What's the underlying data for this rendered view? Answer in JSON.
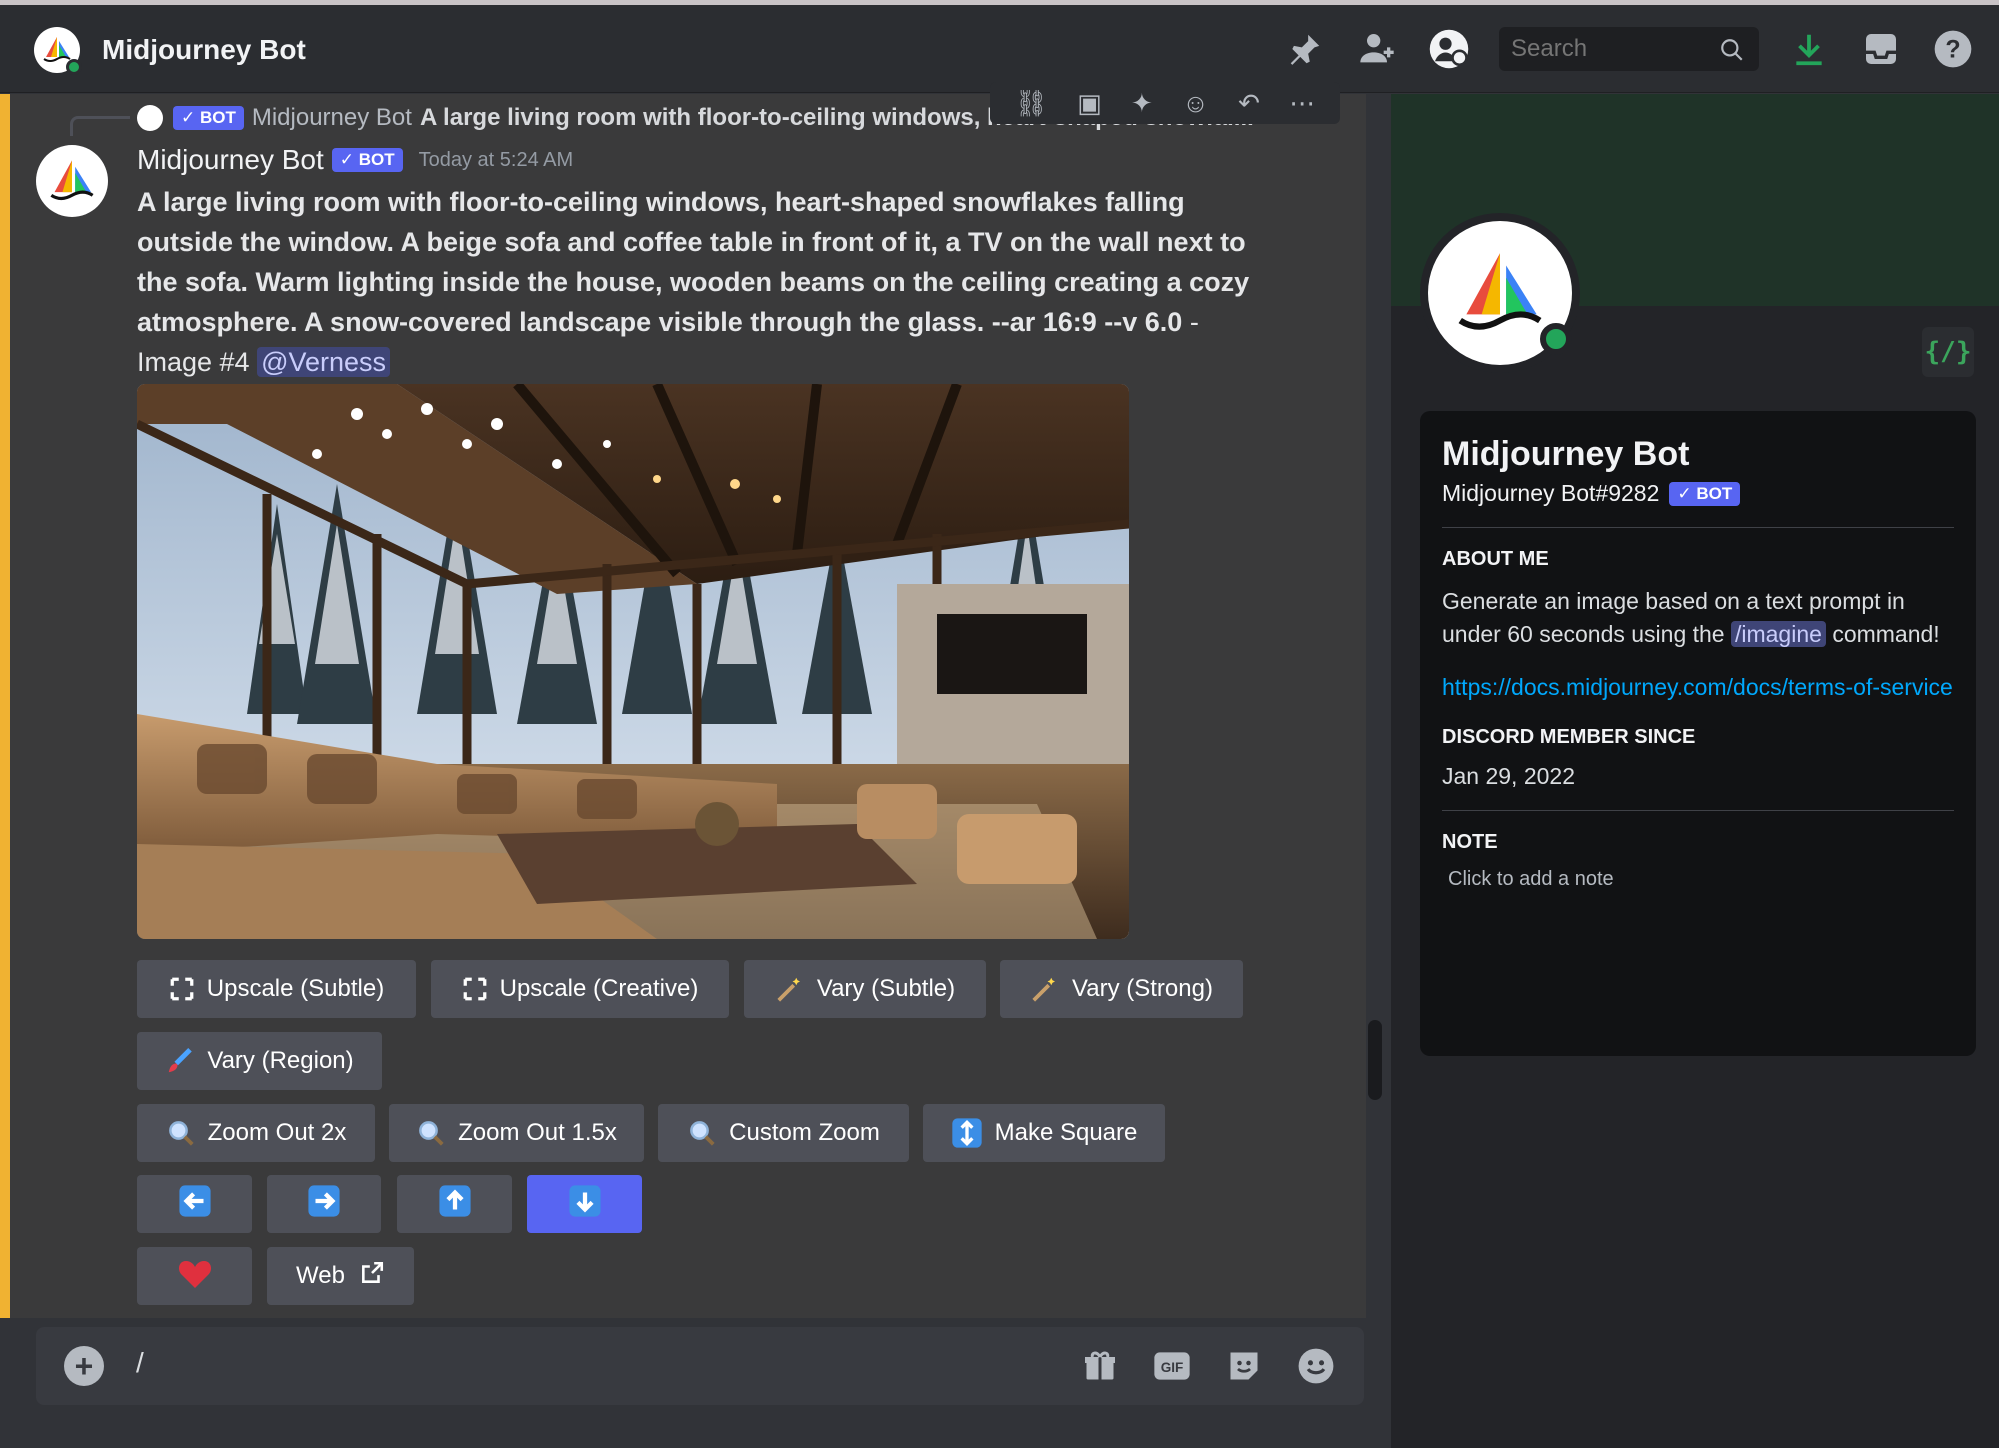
{
  "header": {
    "title": "Midjourney Bot",
    "search_placeholder": "Search"
  },
  "reply": {
    "badge": "✓ BOT",
    "name": "Midjourney Bot",
    "text": "A large living room with floor-to-ceiling windows, heart-shaped snowfal..."
  },
  "message": {
    "author": "Midjourney Bot",
    "badge": "✓ BOT",
    "timestamp": "Today at 5:24 AM",
    "prompt_bold": "A large living room with floor-to-ceiling windows, heart-shaped snowflakes falling outside the window. A beige sofa and coffee table in front of it, a TV on the wall next to the sofa. Warm lighting inside the house, wooden beams on the ceiling creating a cozy atmosphere. A snow-covered landscape visible through the glass. --ar 16:9 --v 6.0",
    "prompt_suffix": " - Image #4 ",
    "mention": "@Verness"
  },
  "buttons": {
    "upscale_subtle": "Upscale (Subtle)",
    "upscale_creative": "Upscale (Creative)",
    "vary_subtle": "Vary (Subtle)",
    "vary_strong": "Vary (Strong)",
    "vary_region": "Vary (Region)",
    "zoom_out_2x": "Zoom Out 2x",
    "zoom_out_15x": "Zoom Out 1.5x",
    "custom_zoom": "Custom Zoom",
    "make_square": "Make Square",
    "web": "Web"
  },
  "composer": {
    "value": "/"
  },
  "profile": {
    "name": "Midjourney Bot",
    "tag": "Midjourney Bot#9282",
    "badge": "✓ BOT",
    "code_badge": "{/}",
    "about_heading": "ABOUT ME",
    "about_text": "Generate an image based on a text prompt in under 60 seconds using the",
    "about_cmd": "/imagine",
    "about_end": "command!",
    "link": "https://docs.midjourney.com/docs/terms-of-service",
    "since_heading": "DISCORD MEMBER SINCE",
    "since": "Jan 29, 2022",
    "note_heading": "NOTE",
    "note_placeholder": "Click to add a note"
  },
  "colors": {
    "accent": "#5865f2",
    "online": "#23a55a",
    "link": "#00a8fc",
    "highlight_bar": "#f0b232"
  }
}
